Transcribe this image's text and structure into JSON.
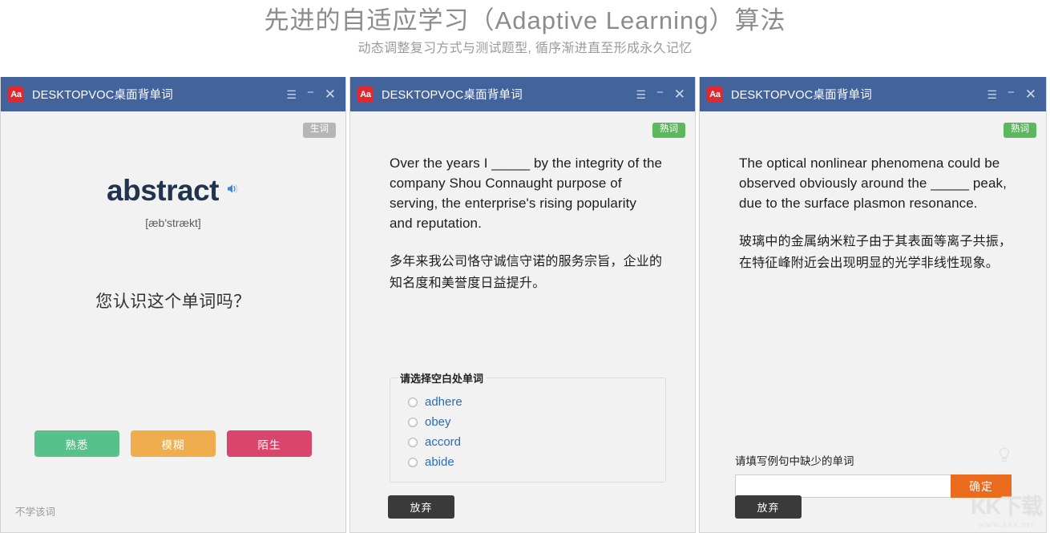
{
  "header": {
    "title": "先进的自适应学习（Adaptive Learning）算法",
    "subtitle": "动态调整复习方式与测试题型, 循序渐进直至形成永久记忆"
  },
  "window": {
    "logo_text": "Aa",
    "title": "DESKTOPVOC桌面背单词",
    "menu_icon": "hamburger-menu-icon",
    "minimize_icon": "minimize-icon",
    "close_icon": "close-icon"
  },
  "panel1": {
    "badge": "生词",
    "word": "abstract",
    "speaker_icon": "speaker-icon",
    "phonetic": "[æb'strækt]",
    "question": "您认识这个单词吗？",
    "choices": [
      {
        "label": "熟悉",
        "color": "#58c08a"
      },
      {
        "label": "模糊",
        "color": "#f0ad4e"
      },
      {
        "label": "陌生",
        "color": "#d9456b"
      }
    ],
    "skip_label": "不学该词"
  },
  "panel2": {
    "badge": "熟词",
    "sentence_en": "Over the years I _____ by the integrity of the company Shou Connaught purpose of serving, the enterprise's rising popularity and reputation.",
    "sentence_zh": "多年来我公司恪守诚信守诺的服务宗旨，企业的知名度和美誉度日益提升。",
    "group_legend": "请选择空白处单词",
    "options": [
      "adhere",
      "obey",
      "accord",
      "abide"
    ],
    "giveup_label": "放弃"
  },
  "panel3": {
    "badge": "熟词",
    "sentence_en": "The optical nonlinear phenomena could be observed obviously around the _____ peak, due to the surface plasmon resonance.",
    "sentence_zh": "玻璃中的金属纳米粒子由于其表面等离子共振，在特征峰附近会出现明显的光学非线性现象。",
    "fill_label": "请填写例句中缺少的单词",
    "hint_icon": "lightbulb-icon",
    "input_value": "",
    "input_placeholder": "",
    "confirm_label": "确定",
    "giveup_label": "放弃"
  },
  "watermark": {
    "main": "KK下载",
    "sub": "www.kkx.net"
  },
  "colors": {
    "titlebar": "#43639c",
    "logo": "#e0282e",
    "badge_new": "#b6b6b6",
    "badge_known": "#5cb85c",
    "confirm": "#ea6a1e",
    "giveup": "#3a3a3a",
    "link": "#2b6cb8"
  }
}
